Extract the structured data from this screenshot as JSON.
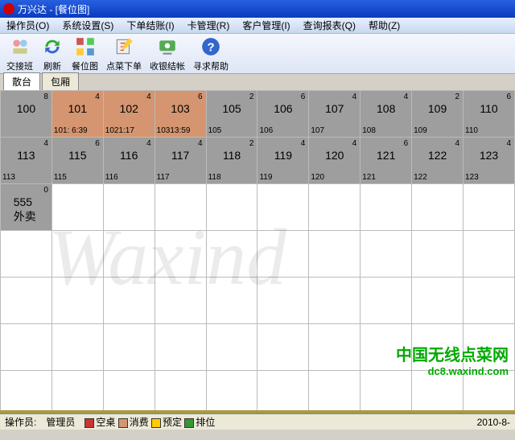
{
  "title": "万兴达 - [餐位图]",
  "menu": [
    "操作员(O)",
    "系统设置(S)",
    "下单结账(I)",
    "卡管理(R)",
    "客户管理(I)",
    "查询报表(Q)",
    "帮助(Z)"
  ],
  "toolbar": [
    {
      "label": "交接班"
    },
    {
      "label": "刷新"
    },
    {
      "label": "餐位图"
    },
    {
      "label": "点菜下单"
    },
    {
      "label": "收银结帐"
    },
    {
      "label": "寻求帮助"
    }
  ],
  "tabs": [
    "散台",
    "包厢"
  ],
  "rows": [
    {
      "label": "100",
      "cells": [
        {
          "num": "100",
          "cap": "8",
          "cls": "gray"
        },
        {
          "num": "101",
          "cap": "4",
          "cls": "orange",
          "time": "101: 6:39"
        },
        {
          "num": "102",
          "cap": "4",
          "cls": "orange",
          "time": "1021:17"
        },
        {
          "num": "103",
          "cap": "6",
          "cls": "orange",
          "time": "10313:59"
        },
        {
          "num": "105",
          "cap": "2",
          "cls": "gray",
          "time": "105"
        },
        {
          "num": "106",
          "cap": "6",
          "cls": "gray",
          "time": "106"
        },
        {
          "num": "107",
          "cap": "4",
          "cls": "gray",
          "time": "107"
        },
        {
          "num": "108",
          "cap": "4",
          "cls": "gray",
          "time": "108"
        },
        {
          "num": "109",
          "cap": "2",
          "cls": "gray",
          "time": "109"
        },
        {
          "num": "110",
          "cap": "6",
          "cls": "gray",
          "time": "110"
        }
      ]
    },
    {
      "label": "113",
      "cells": [
        {
          "num": "113",
          "cap": "4",
          "cls": "gray",
          "time": "113"
        },
        {
          "num": "115",
          "cap": "6",
          "cls": "gray",
          "time": "115"
        },
        {
          "num": "116",
          "cap": "4",
          "cls": "gray",
          "time": "116"
        },
        {
          "num": "117",
          "cap": "4",
          "cls": "gray",
          "time": "117"
        },
        {
          "num": "118",
          "cap": "2",
          "cls": "gray",
          "time": "118"
        },
        {
          "num": "119",
          "cap": "4",
          "cls": "gray",
          "time": "119"
        },
        {
          "num": "120",
          "cap": "4",
          "cls": "gray",
          "time": "120"
        },
        {
          "num": "121",
          "cap": "6",
          "cls": "gray",
          "time": "121"
        },
        {
          "num": "122",
          "cap": "4",
          "cls": "gray",
          "time": "122"
        },
        {
          "num": "123",
          "cap": "4",
          "cls": "gray",
          "time": "123"
        }
      ]
    },
    {
      "label": "555",
      "cells": [
        {
          "num": "555 外卖",
          "cap": "0",
          "cls": "gray"
        },
        {},
        {},
        {},
        {},
        {},
        {},
        {},
        {},
        {}
      ]
    },
    {
      "label": "",
      "cells": [
        {},
        {},
        {},
        {},
        {},
        {},
        {},
        {},
        {},
        {}
      ]
    },
    {
      "label": "",
      "cells": [
        {},
        {},
        {},
        {},
        {},
        {},
        {},
        {},
        {},
        {}
      ]
    },
    {
      "label": "",
      "cells": [
        {},
        {},
        {},
        {},
        {},
        {},
        {},
        {},
        {},
        {}
      ]
    },
    {
      "label": "",
      "cells": [
        {},
        {},
        {},
        {},
        {},
        {},
        {},
        {},
        {},
        {}
      ]
    }
  ],
  "watermark_main": "Waxind",
  "watermark_cn": "中国无线点菜网",
  "watermark_url": "dc8.waxind.com",
  "status": {
    "operator_label": "操作员:",
    "operator": "管理员",
    "legend": [
      {
        "cls": "sw-empty",
        "text": "空桌"
      },
      {
        "cls": "sw-open",
        "text": "消费"
      },
      {
        "cls": "sw-reserve",
        "text": "预定"
      },
      {
        "cls": "sw-wait",
        "text": "排位"
      }
    ],
    "date": "2010-8-"
  }
}
